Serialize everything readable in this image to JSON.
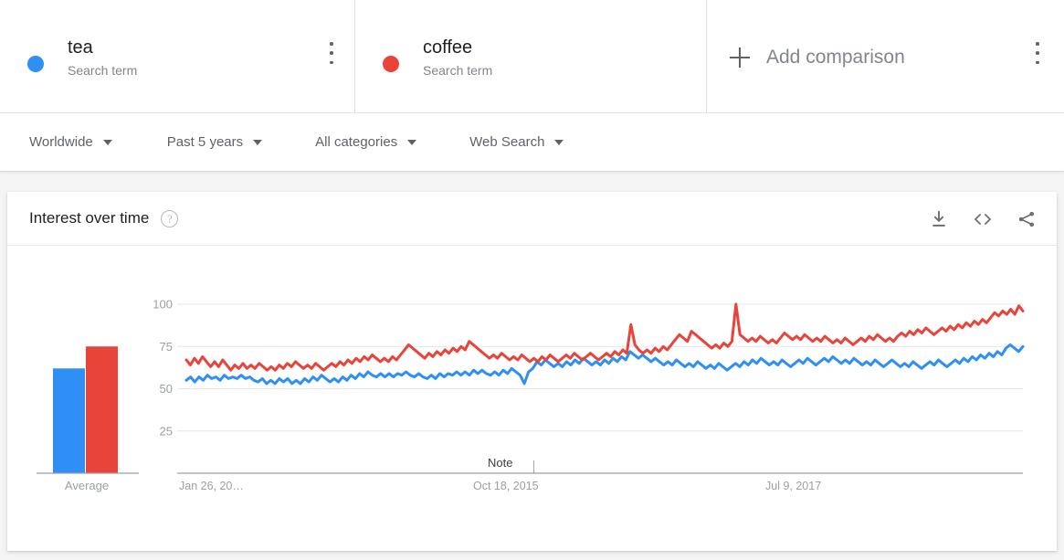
{
  "terms": [
    {
      "name": "tea",
      "subtitle": "Search term",
      "color": "#2f8ff5",
      "menu_icon": "kebab-menu-icon"
    },
    {
      "name": "coffee",
      "subtitle": "Search term",
      "color": "#e8443a",
      "menu_icon": "kebab-menu-icon"
    }
  ],
  "add_comparison": {
    "label": "Add comparison",
    "icon": "plus-icon"
  },
  "filters": [
    {
      "label": "Worldwide"
    },
    {
      "label": "Past 5 years"
    },
    {
      "label": "All categories"
    },
    {
      "label": "Web Search"
    }
  ],
  "card": {
    "title": "Interest over time",
    "help_icon": "?",
    "tools": [
      {
        "name": "download-icon"
      },
      {
        "name": "embed-code-icon"
      },
      {
        "name": "share-icon"
      }
    ]
  },
  "chart_data": {
    "type": "line",
    "title": "Interest over time",
    "xlabel": "",
    "ylabel": "",
    "ylim": [
      0,
      100
    ],
    "yticks": [
      100,
      75,
      50,
      25
    ],
    "xticks": [
      "Jan 26, 20…",
      "Oct 18, 2015",
      "Jul 9, 2017"
    ],
    "grid": true,
    "legend": "none",
    "annotations": [
      {
        "label": "Note",
        "x_fraction": 0.4155
      }
    ],
    "average_panel": {
      "label": "Average",
      "values": [
        62,
        75
      ],
      "series_names": [
        "tea",
        "coffee"
      ],
      "colors": [
        "#2f8ff5",
        "#e8443a"
      ]
    },
    "series": [
      {
        "name": "tea",
        "color": "#2f8ff5",
        "values": [
          55,
          57,
          54,
          57,
          55,
          58,
          56,
          57,
          55,
          58,
          56,
          57,
          56,
          58,
          56,
          57,
          55,
          54,
          56,
          53,
          55,
          53,
          56,
          54,
          56,
          53,
          55,
          53,
          56,
          54,
          57,
          55,
          58,
          56,
          54,
          56,
          54,
          57,
          55,
          58,
          56,
          59,
          57,
          60,
          58,
          57,
          59,
          57,
          59,
          57,
          59,
          58,
          60,
          58,
          57,
          59,
          57,
          56,
          58,
          56,
          59,
          57,
          59,
          58,
          60,
          58,
          60,
          58,
          61,
          59,
          61,
          59,
          58,
          60,
          58,
          61,
          59,
          62,
          60,
          58,
          53,
          60,
          62,
          66,
          64,
          67,
          65,
          63,
          65,
          63,
          66,
          64,
          67,
          65,
          68,
          66,
          64,
          66,
          64,
          67,
          65,
          68,
          66,
          69,
          67,
          72,
          70,
          68,
          70,
          68,
          66,
          68,
          66,
          64,
          66,
          64,
          67,
          65,
          63,
          65,
          63,
          66,
          64,
          62,
          64,
          62,
          65,
          63,
          61,
          63,
          65,
          63,
          66,
          64,
          67,
          65,
          68,
          66,
          64,
          66,
          64,
          67,
          65,
          63,
          65,
          67,
          65,
          68,
          66,
          64,
          66,
          68,
          66,
          69,
          67,
          65,
          67,
          65,
          68,
          66,
          64,
          66,
          64,
          67,
          65,
          63,
          65,
          67,
          65,
          63,
          65,
          63,
          66,
          64,
          62,
          64,
          66,
          64,
          67,
          65,
          63,
          65,
          67,
          65,
          68,
          66,
          69,
          67,
          70,
          68,
          71,
          69,
          72,
          70,
          74,
          76,
          74,
          72,
          75
        ]
      },
      {
        "name": "coffee",
        "color": "#e8443a",
        "values": [
          67,
          64,
          68,
          65,
          69,
          66,
          63,
          66,
          63,
          67,
          64,
          61,
          64,
          62,
          65,
          62,
          64,
          62,
          65,
          63,
          61,
          63,
          61,
          64,
          62,
          65,
          63,
          66,
          64,
          62,
          64,
          62,
          65,
          63,
          61,
          63,
          65,
          63,
          66,
          64,
          67,
          65,
          68,
          66,
          69,
          67,
          70,
          68,
          66,
          68,
          66,
          69,
          67,
          70,
          73,
          76,
          74,
          72,
          70,
          68,
          71,
          69,
          72,
          70,
          73,
          71,
          74,
          72,
          75,
          73,
          78,
          76,
          74,
          72,
          70,
          68,
          70,
          68,
          71,
          69,
          67,
          69,
          67,
          70,
          68,
          66,
          68,
          66,
          69,
          67,
          70,
          68,
          66,
          68,
          70,
          68,
          71,
          69,
          67,
          69,
          71,
          69,
          67,
          69,
          71,
          69,
          72,
          70,
          73,
          71,
          88,
          76,
          73,
          71,
          73,
          71,
          74,
          72,
          75,
          73,
          76,
          79,
          82,
          80,
          78,
          84,
          82,
          80,
          78,
          76,
          74,
          76,
          74,
          77,
          75,
          78,
          100,
          82,
          80,
          78,
          80,
          78,
          81,
          79,
          77,
          79,
          77,
          80,
          83,
          81,
          79,
          81,
          79,
          82,
          80,
          78,
          80,
          78,
          81,
          79,
          77,
          79,
          77,
          80,
          78,
          76,
          78,
          80,
          78,
          81,
          79,
          82,
          80,
          78,
          80,
          78,
          81,
          83,
          81,
          84,
          82,
          85,
          83,
          86,
          84,
          82,
          84,
          86,
          84,
          87,
          85,
          88,
          86,
          89,
          87,
          90,
          88,
          91,
          89,
          92,
          95,
          93,
          96,
          94,
          97,
          94,
          99,
          96
        ]
      }
    ]
  }
}
